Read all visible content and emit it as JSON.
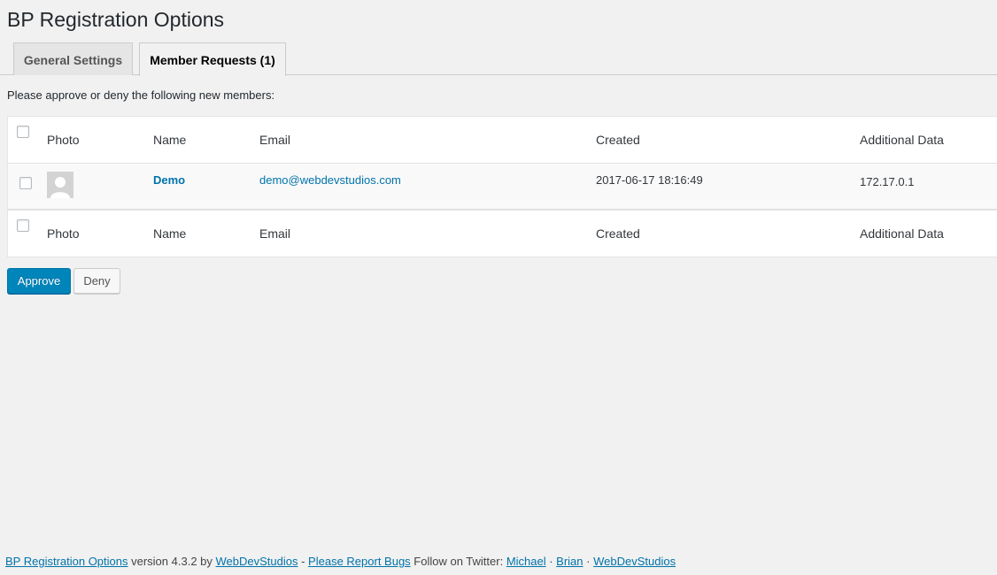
{
  "page": {
    "title": "BP Registration Options",
    "intro": "Please approve or deny the following new members:"
  },
  "tabs": [
    {
      "label": "General Settings",
      "active": false
    },
    {
      "label": "Member Requests (1)",
      "active": true
    }
  ],
  "table": {
    "columns": [
      "Photo",
      "Name",
      "Email",
      "Created",
      "Additional Data"
    ],
    "rows": [
      {
        "name": "Demo",
        "email": "demo@webdevstudios.com",
        "created": "2017-06-17 18:16:49",
        "additional": "172.17.0.1"
      }
    ]
  },
  "actions": {
    "approve": "Approve",
    "deny": "Deny"
  },
  "footer": {
    "plugin_link": "BP Registration Options",
    "version_text": " version 4.3.2 by ",
    "author_link": "WebDevStudios",
    "sep1": " - ",
    "bugs_link": "Please Report Bugs",
    "twitter_text": " Follow on Twitter: ",
    "michael_link": "Michael",
    "dot1": " · ",
    "brian_link": "Brian",
    "dot2": " · ",
    "wds_link": "WebDevStudios"
  },
  "colors": {
    "primary": "#0085ba",
    "link": "#0073aa",
    "background": "#f1f1f1"
  }
}
